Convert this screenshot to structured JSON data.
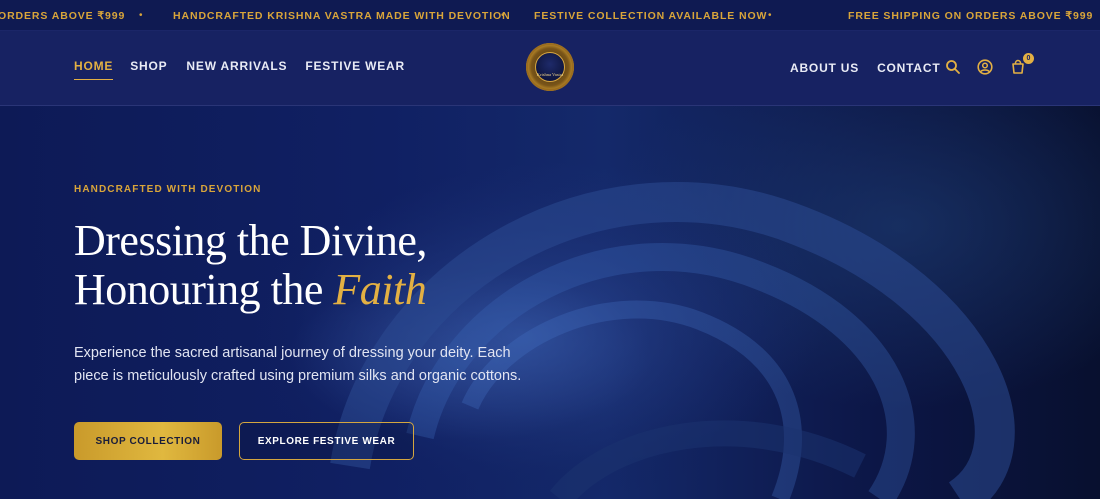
{
  "announcement_bar": {
    "items": [
      "ORDERS ABOVE ₹999",
      "HANDCRAFTED KRISHNA VASTRA MADE WITH DEVOTION",
      "FESTIVE COLLECTION AVAILABLE NOW",
      "FREE SHIPPING ON ORDERS ABOVE ₹999"
    ],
    "separator": "•"
  },
  "header": {
    "nav_left": [
      "HOME",
      "SHOP",
      "NEW ARRIVALS",
      "FESTIVE WEAR"
    ],
    "active_nav": "HOME",
    "logo_text": "Krishna Vastra",
    "nav_right": [
      "ABOUT US",
      "CONTACT"
    ],
    "icons": [
      "search-icon",
      "account-icon",
      "cart-icon"
    ],
    "cart_count": "0"
  },
  "hero": {
    "eyebrow": "HANDCRAFTED WITH DEVOTION",
    "headline_line1": "Dressing the Divine,",
    "headline_line2_prefix": "Honouring the ",
    "headline_line2_accent": "Faith",
    "subcopy": "Experience the sacred artisanal journey of dressing your deity. Each piece is meticulously crafted using premium silks and organic cottons.",
    "primary_cta": "SHOP COLLECTION",
    "secondary_cta": "EXPLORE FESTIVE WEAR"
  },
  "colors": {
    "navy": "#172262",
    "gold": "#e3b043",
    "text_light": "#e1e4f2"
  }
}
